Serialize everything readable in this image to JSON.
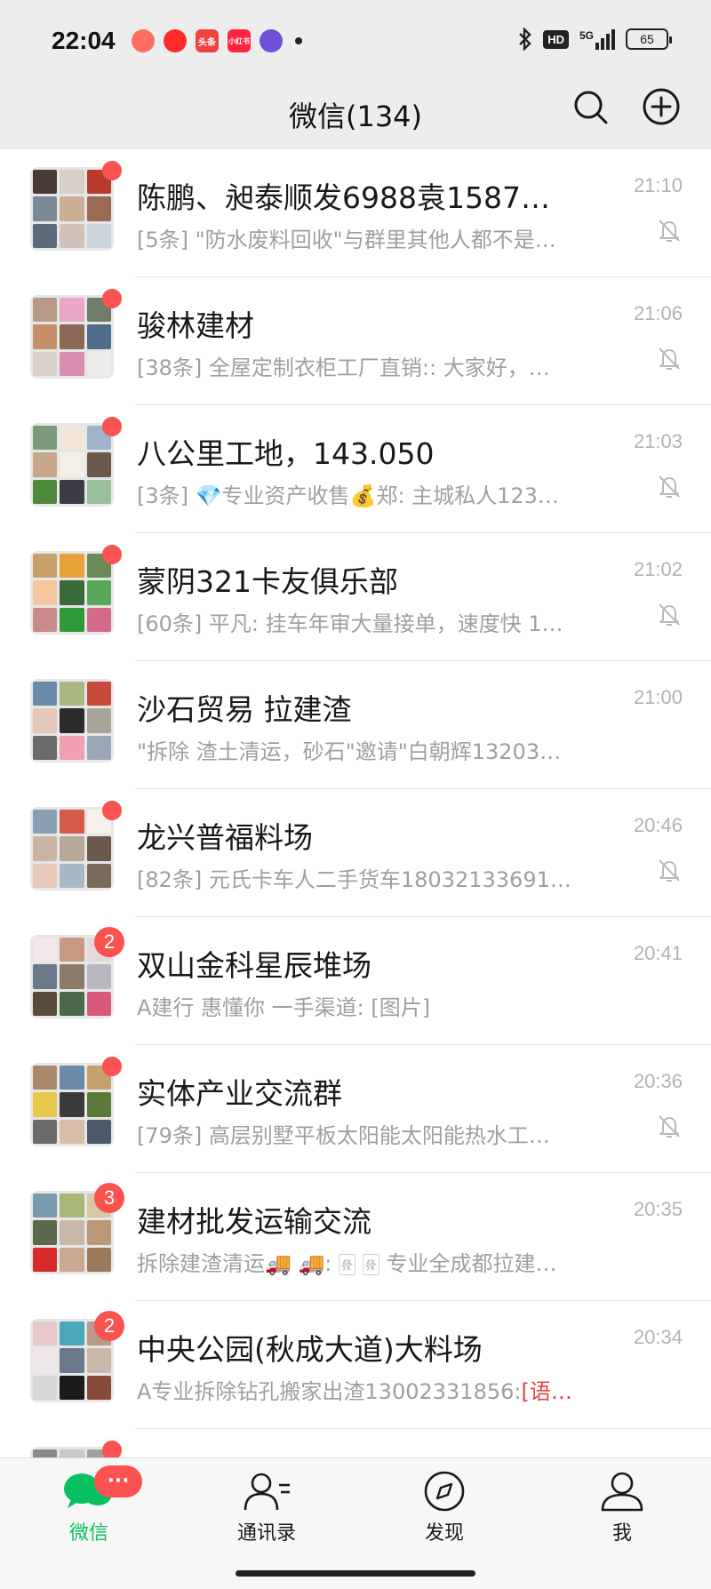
{
  "status_bar": {
    "time": "22:04",
    "apps": [
      {
        "icon": "daily-app-icon",
        "label": "",
        "color": "#ff6f61"
      },
      {
        "icon": "video-app-icon",
        "label": "",
        "color": "#ff2a2a"
      },
      {
        "icon": "toutiao-app-icon",
        "label": "头条",
        "color": "#f04142"
      },
      {
        "icon": "xiaohongshu-app-icon",
        "label": "小红书",
        "color": "#ff2442"
      },
      {
        "icon": "purple-app-icon",
        "label": "",
        "color": "#6f4fd6"
      }
    ],
    "hd": "HD",
    "network": "5G",
    "battery": "65"
  },
  "header": {
    "title": "微信(134)",
    "search_icon": "search-icon",
    "add_icon": "plus-circle-icon"
  },
  "chats": [
    {
      "name": "陈鹏、昶泰顺发6988袁15871…",
      "preview": "[5条] \"防水废料回收\"与群里其他人都不是…",
      "time": "21:10",
      "badge": "dot",
      "muted": true,
      "avatar": [
        "#4a3a35",
        "#d8d0c8",
        "#b83a2a",
        "#7a8a98",
        "#c9b094",
        "#9a6a55",
        "#5a6a7a",
        "#d0c2b8",
        "#cdd5dd"
      ]
    },
    {
      "name": "骏林建材",
      "preview": "[38条] 全屋定制衣柜工厂直销:: 大家好，…",
      "time": "21:06",
      "badge": "dot",
      "muted": true,
      "avatar": [
        "#b89a86",
        "#e9a7c5",
        "#6f7c6a",
        "#c58f6a",
        "#8a6a55",
        "#506c8a",
        "#dad2cb",
        "#d98fb0",
        "#ededed"
      ]
    },
    {
      "name": "八公里工地，143.050",
      "preview": "[3条] 💎专业资产收售💰郑: 主城私人123…",
      "time": "21:03",
      "badge": "dot",
      "muted": true,
      "avatar": [
        "#7a9a7a",
        "#f2e6d8",
        "#9fb3c8",
        "#c7a78a",
        "#f3efe6",
        "#6b5a4a",
        "#4e8a3e",
        "#3b3b44",
        "#9ac09a"
      ]
    },
    {
      "name": "蒙阴321卡友俱乐部",
      "preview": "[60条] 平凡: 挂车年审大量接单，速度快 1…",
      "time": "21:02",
      "badge": "dot",
      "muted": true,
      "avatar": [
        "#c7a06a",
        "#e8a23a",
        "#6a8a5a",
        "#f6c6a0",
        "#3a6a3a",
        "#5aa85a",
        "#c98a8a",
        "#2f9a3a",
        "#d46a8a"
      ]
    },
    {
      "name": "沙石贸易 拉建渣",
      "preview": "\"拆除 渣土清运，砂石\"邀请\"白朝辉13203…",
      "time": "21:00",
      "badge": "none",
      "muted": false,
      "avatar": [
        "#6a8aa8",
        "#a8b880",
        "#c84a3a",
        "#e6c6b8",
        "#2a2a2a",
        "#a8a49a",
        "#6a6a6a",
        "#f0a0b0",
        "#9aa8b8"
      ]
    },
    {
      "name": "龙兴普福料场",
      "preview": "[82条] 元氏卡车人二手货车18032133691:…",
      "time": "20:46",
      "badge": "dot",
      "muted": true,
      "avatar": [
        "#8aa0b0",
        "#d45a4a",
        "#f5f0ea",
        "#c8b4a0",
        "#b8a898",
        "#6a5a4a",
        "#e8c8b8",
        "#a8b8c8",
        "#7a6a5a"
      ]
    },
    {
      "name": "双山金科星辰堆场",
      "preview": "A建行  惠懂你  一手渠道: [图片]",
      "time": "20:41",
      "badge": "2",
      "muted": false,
      "avatar": [
        "#f3e8ea",
        "#c89a84",
        "#e5d8d8",
        "#6a7a8a",
        "#8a7a6a",
        "#b8b8c0",
        "#5a4a3a",
        "#4a6a4a",
        "#d85a7a"
      ]
    },
    {
      "name": "实体产业交流群",
      "preview": "[79条] 高层别墅平板太阳能太阳能热水工…",
      "time": "20:36",
      "badge": "dot",
      "muted": true,
      "avatar": [
        "#a88a6a",
        "#6a8aa8",
        "#c8a070",
        "#e6c84a",
        "#3a3a3a",
        "#5a7a3a",
        "#6a6a6a",
        "#d8c0a8",
        "#4a5a6a"
      ]
    },
    {
      "name": "建材批发运输交流",
      "preview": "拆除建渣清运🚚 🚚: 🀅 🀅 专业全成都拉建…",
      "time": "20:35",
      "badge": "3",
      "muted": false,
      "avatar": [
        "#7a9ab0",
        "#a8b878",
        "#d8c8a8",
        "#5a6a4a",
        "#c8b8a8",
        "#b89878",
        "#d82a2a",
        "#c8a890",
        "#9a7a5a"
      ]
    },
    {
      "name": "中央公园(秋成大道)大料场",
      "preview_prefix": "A专业拆除钻孔搬家出渣13002331856:",
      "preview_red": "[语…",
      "time": "20:34",
      "badge": "2",
      "muted": false,
      "avatar": [
        "#e8c8c8",
        "#4aa8b8",
        "#b89a8a",
        "#f0e8e8",
        "#6a7a8a",
        "#c8b8a8",
        "#d8d8d8",
        "#1a1a1a",
        "#8a4a3a"
      ]
    },
    {
      "name": "",
      "preview": "",
      "time": "",
      "badge": "dot",
      "muted": false,
      "avatar": [
        "#8a8a8a",
        "#c8c8c8",
        "#a0a0a0",
        "#d0d0d0",
        "#b0b0b0",
        "#c0c0c0",
        "#909090",
        "#a8a8a8",
        "#b8b8b8"
      ]
    }
  ],
  "tabs": [
    {
      "label": "微信",
      "icon": "chat-bubbles-icon",
      "active": true,
      "badge": "···"
    },
    {
      "label": "通讯录",
      "icon": "contacts-icon",
      "active": false
    },
    {
      "label": "发现",
      "icon": "compass-icon",
      "active": false
    },
    {
      "label": "我",
      "icon": "person-icon",
      "active": false
    }
  ],
  "colors": {
    "accent": "#07c160",
    "badge": "#fa5151",
    "header_bg": "#ededed"
  }
}
